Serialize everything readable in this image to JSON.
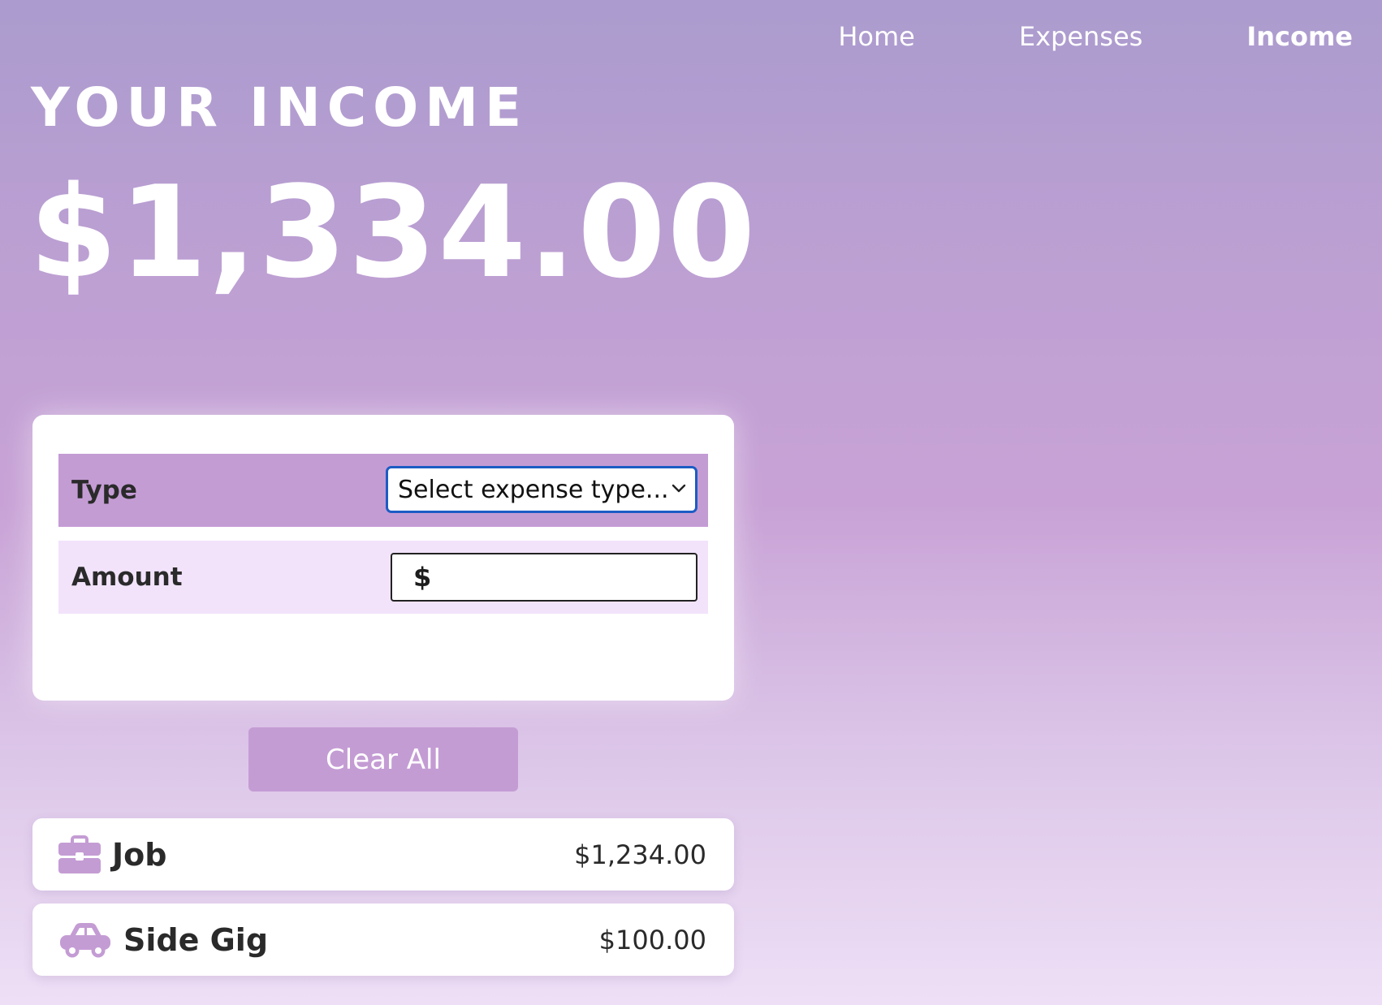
{
  "nav": {
    "items": [
      {
        "label": "Home",
        "active": false
      },
      {
        "label": "Expenses",
        "active": false
      },
      {
        "label": "Income",
        "active": true
      }
    ]
  },
  "header": {
    "title": "YOUR INCOME",
    "total": "$1,334.00"
  },
  "form": {
    "type_label": "Type",
    "type_select": {
      "value": "Select expense type...",
      "focused": true
    },
    "amount_label": "Amount",
    "amount_prefix": "$",
    "amount_value": ""
  },
  "actions": {
    "clear_label": "Clear All"
  },
  "income_items": [
    {
      "name": "Job",
      "amount": "$1,234.00",
      "icon": "briefcase-icon"
    },
    {
      "name": "Side Gig",
      "amount": "$100.00",
      "icon": "car-icon"
    }
  ],
  "colors": {
    "accent": "#c49cd4",
    "accent_light": "#f2e3fb",
    "focus_ring": "#1c5cc4",
    "text_dark": "#2a2a2a"
  }
}
